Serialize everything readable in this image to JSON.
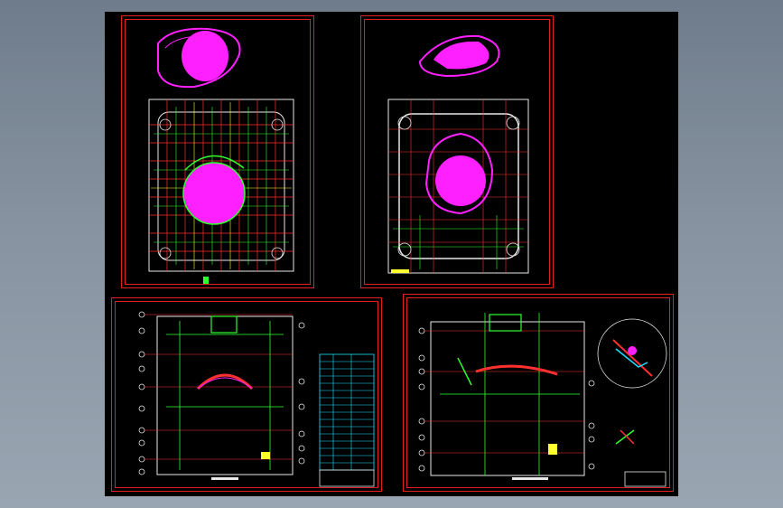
{
  "window": {
    "background_color": "#7a8796",
    "viewport_color": "#000000"
  },
  "colors": {
    "border": "#e02020",
    "magenta": "#ff20ff",
    "green": "#30ff30",
    "cyan": "#20e0ff",
    "yellow": "#ffff30",
    "white": "#e8e8e8",
    "red": "#ff3030"
  },
  "sheets": [
    {
      "id": "top-left",
      "type": "plan-view-core"
    },
    {
      "id": "top-right",
      "type": "plan-view-cavity"
    },
    {
      "id": "bottom-left",
      "type": "section-view-with-bom"
    },
    {
      "id": "bottom-right",
      "type": "section-view-with-detail"
    }
  ]
}
